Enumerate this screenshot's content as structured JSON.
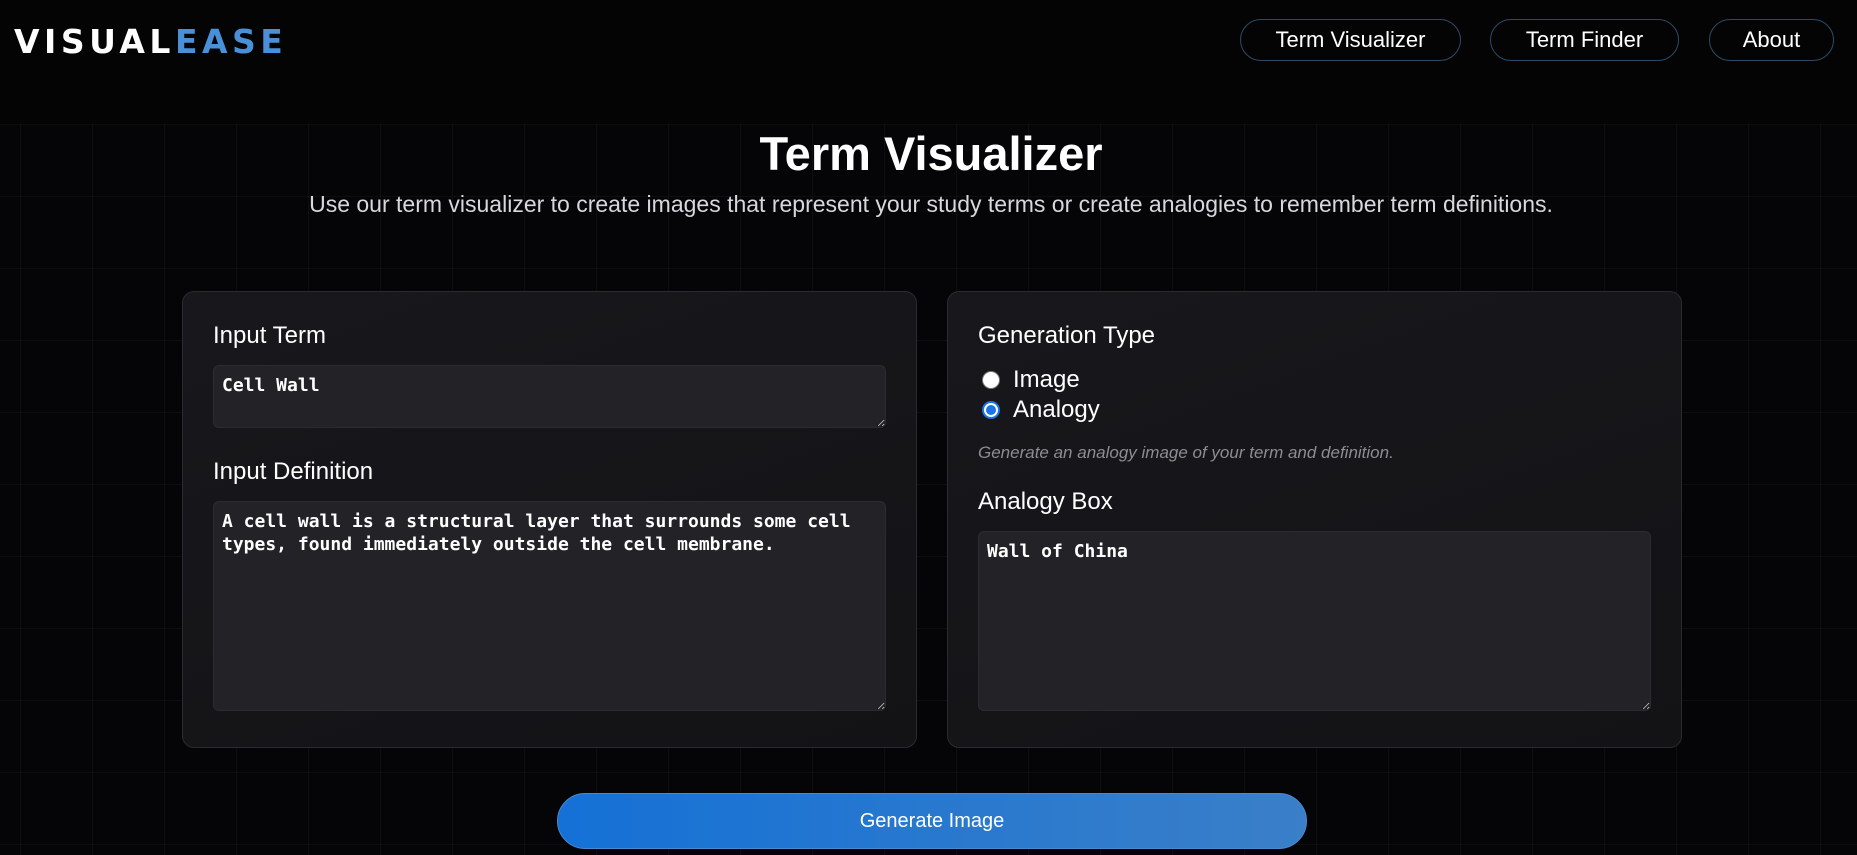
{
  "header": {
    "logo_part1": "VISUAL",
    "logo_part2": "EASE",
    "nav": [
      "Term Visualizer",
      "Term Finder",
      "About"
    ]
  },
  "page": {
    "title": "Term Visualizer",
    "subtitle": "Use our term visualizer to create images that represent your study terms or create analogies to remember term definitions."
  },
  "left_panel": {
    "term_label": "Input Term",
    "term_value": "Cell Wall",
    "definition_label": "Input Definition",
    "definition_value": "A cell wall is a structural layer that surrounds some cell types, found immediately outside the cell membrane."
  },
  "right_panel": {
    "generation_type_label": "Generation Type",
    "options": [
      "Image",
      "Analogy"
    ],
    "selected_option": "Analogy",
    "hint": "Generate an analogy image of your term and definition.",
    "analogy_label": "Analogy Box",
    "analogy_value": "Wall of China"
  },
  "actions": {
    "generate_label": "Generate Image"
  },
  "colors": {
    "accent": "#4a90d9",
    "button": "#1571d6",
    "background": "#050507"
  }
}
